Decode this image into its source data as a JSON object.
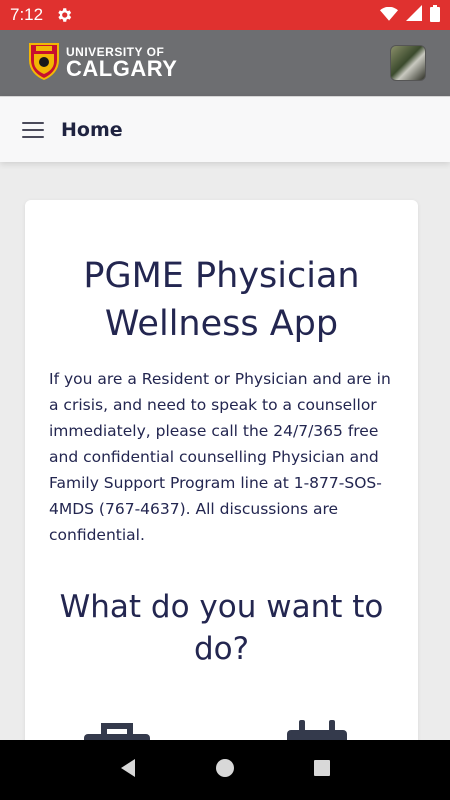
{
  "status_bar": {
    "time": "7:12",
    "icons": [
      "settings-gear-icon",
      "wifi-icon",
      "cellular-signal-icon",
      "battery-icon"
    ],
    "background": "#e0312f"
  },
  "header": {
    "logo_line1": "UNIVERSITY OF",
    "logo_line2": "CALGARY",
    "background": "#6d6e71"
  },
  "nav": {
    "title": "Home"
  },
  "card": {
    "title": "PGME Physician Wellness App",
    "body": "If you are a Resident or Physician and are in a crisis, and need to speak to a counsellor immediately, please call the 24/7/365 free and confidential counselling Physician and Family Support Program line at 1-877-SOS-4MDS (767-4637). All discussions are confidential.",
    "question": "What do you want to do?",
    "text_color": "#232650"
  },
  "actions": {
    "icons": [
      "briefcase-icon",
      "calendar-icon"
    ]
  },
  "system_nav": {
    "buttons": [
      "back-icon",
      "home-icon",
      "recents-icon"
    ]
  }
}
